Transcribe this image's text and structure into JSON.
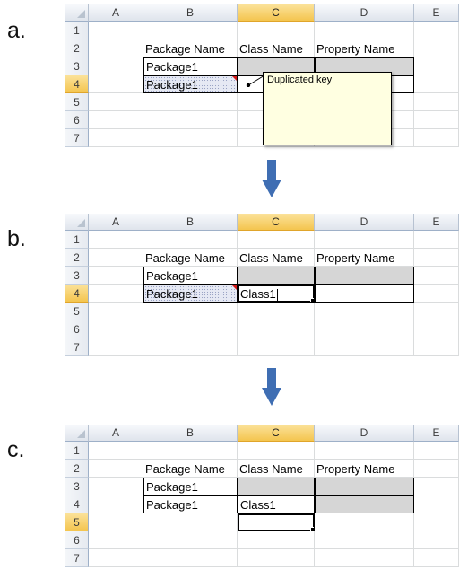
{
  "steps": [
    {
      "label": "a.",
      "columns": [
        "A",
        "B",
        "C",
        "D",
        "E"
      ],
      "selected_column": "C",
      "rows": [
        {
          "num": "1",
          "cells": [
            "",
            "",
            "",
            "",
            ""
          ]
        },
        {
          "num": "2",
          "cells": [
            "",
            "Package Name",
            "Class Name",
            "Property Name",
            ""
          ]
        },
        {
          "num": "3",
          "cells": [
            "",
            "Package1",
            "",
            "",
            ""
          ]
        },
        {
          "num": "4",
          "cells": [
            "",
            "Package1",
            "",
            "",
            ""
          ]
        },
        {
          "num": "5",
          "cells": [
            "",
            "",
            "",
            "",
            ""
          ]
        },
        {
          "num": "6",
          "cells": [
            "",
            "",
            "",
            "",
            ""
          ]
        },
        {
          "num": "7",
          "cells": [
            "",
            "",
            "",
            "",
            ""
          ]
        }
      ],
      "selected_row": "4",
      "comment": "Duplicated key"
    },
    {
      "label": "b.",
      "columns": [
        "A",
        "B",
        "C",
        "D",
        "E"
      ],
      "selected_column": "C",
      "rows": [
        {
          "num": "1",
          "cells": [
            "",
            "",
            "",
            "",
            ""
          ]
        },
        {
          "num": "2",
          "cells": [
            "",
            "Package Name",
            "Class Name",
            "Property Name",
            ""
          ]
        },
        {
          "num": "3",
          "cells": [
            "",
            "Package1",
            "",
            "",
            ""
          ]
        },
        {
          "num": "4",
          "cells": [
            "",
            "Package1",
            "Class1",
            "",
            ""
          ]
        },
        {
          "num": "5",
          "cells": [
            "",
            "",
            "",
            "",
            ""
          ]
        },
        {
          "num": "6",
          "cells": [
            "",
            "",
            "",
            "",
            ""
          ]
        },
        {
          "num": "7",
          "cells": [
            "",
            "",
            "",
            "",
            ""
          ]
        }
      ],
      "selected_row": "4"
    },
    {
      "label": "c.",
      "columns": [
        "A",
        "B",
        "C",
        "D",
        "E"
      ],
      "selected_column": "C",
      "rows": [
        {
          "num": "1",
          "cells": [
            "",
            "",
            "",
            "",
            ""
          ]
        },
        {
          "num": "2",
          "cells": [
            "",
            "Package Name",
            "Class Name",
            "Property Name",
            ""
          ]
        },
        {
          "num": "3",
          "cells": [
            "",
            "Package1",
            "",
            "",
            ""
          ]
        },
        {
          "num": "4",
          "cells": [
            "",
            "Package1",
            "Class1",
            "",
            ""
          ]
        },
        {
          "num": "5",
          "cells": [
            "",
            "",
            "",
            "",
            ""
          ]
        },
        {
          "num": "6",
          "cells": [
            "",
            "",
            "",
            "",
            ""
          ]
        },
        {
          "num": "7",
          "cells": [
            "",
            "",
            "",
            "",
            ""
          ]
        }
      ],
      "selected_row": "5"
    }
  ],
  "colors": {
    "selected_header": "#f4c54f",
    "gray_cell": "#d6d6d6",
    "comment_bg": "#ffffe1",
    "arrow": "#3f6eb3"
  },
  "icons": [
    "select-all-corner-icon",
    "down-arrow-icon",
    "error-indicator-icon"
  ]
}
